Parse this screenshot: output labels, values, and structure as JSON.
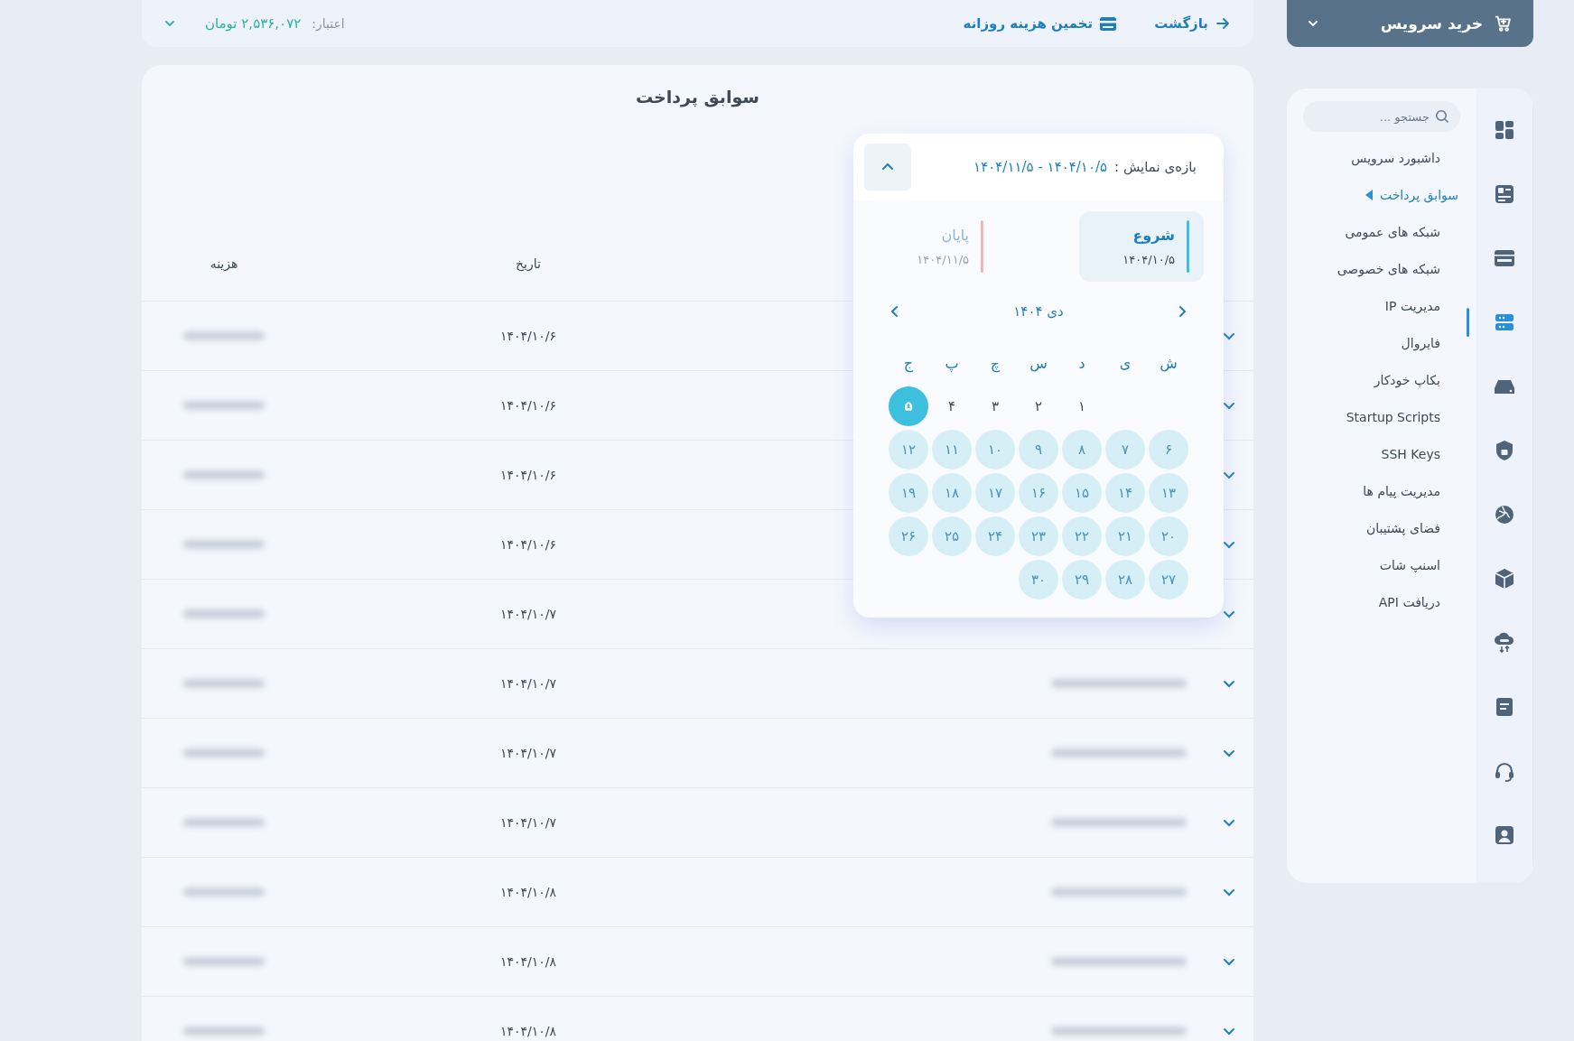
{
  "top_bar": {
    "back": "بازگشت",
    "estimate": "تخمین هزینه روزانه",
    "credit_label": "اعتبار:",
    "credit_value": "۲,۵۳۶,۰۷۲ تومان"
  },
  "buy_button": {
    "label": "خرید سرویس"
  },
  "search": {
    "placeholder": "جستجو ..."
  },
  "menu": [
    {
      "label": "داشبورد سرویس",
      "selected": false
    },
    {
      "label": "سوابق پرداخت",
      "selected": true
    },
    {
      "label": "شبکه های عمومی",
      "selected": false
    },
    {
      "label": "شبکه های خصوصی",
      "selected": false
    },
    {
      "label": "مدیریت IP",
      "selected": false
    },
    {
      "label": "فایروال",
      "selected": false
    },
    {
      "label": "بکاپ خودکار",
      "selected": false
    },
    {
      "label": "Startup Scripts",
      "selected": false
    },
    {
      "label": "SSH Keys",
      "selected": false
    },
    {
      "label": "مدیریت پیام ها",
      "selected": false
    },
    {
      "label": "فضای پشتیبان",
      "selected": false
    },
    {
      "label": "اسنپ شات",
      "selected": false
    },
    {
      "label": "دریافت API",
      "selected": false
    }
  ],
  "rail": [
    {
      "kind": "grid",
      "selected": false
    },
    {
      "kind": "dashboard",
      "selected": false
    },
    {
      "kind": "web",
      "selected": false
    },
    {
      "kind": "server",
      "selected": true
    },
    {
      "kind": "drive",
      "selected": false
    },
    {
      "kind": "shield",
      "selected": false
    },
    {
      "kind": "globe",
      "selected": false
    },
    {
      "kind": "cube",
      "selected": false
    },
    {
      "kind": "cloud",
      "selected": false
    },
    {
      "kind": "document",
      "selected": false
    },
    {
      "kind": "headset",
      "selected": false
    },
    {
      "kind": "user",
      "selected": false
    }
  ],
  "page_title": "سوابق پرداخت",
  "table": {
    "columns": [
      {
        "label": "تاریخ"
      },
      {
        "label": "هزینه"
      }
    ],
    "rows": [
      {
        "date": "۱۴۰۴/۱۰/۶"
      },
      {
        "date": "۱۴۰۴/۱۰/۶"
      },
      {
        "date": "۱۴۰۴/۱۰/۶"
      },
      {
        "date": "۱۴۰۴/۱۰/۶"
      },
      {
        "date": "۱۴۰۴/۱۰/۷"
      },
      {
        "date": "۱۴۰۴/۱۰/۷"
      },
      {
        "date": "۱۴۰۴/۱۰/۷"
      },
      {
        "date": "۱۴۰۴/۱۰/۷"
      },
      {
        "date": "۱۴۰۴/۱۰/۸"
      },
      {
        "date": "۱۴۰۴/۱۰/۸"
      },
      {
        "date": "۱۴۰۴/۱۰/۸"
      }
    ]
  },
  "date_picker": {
    "range_label": "بازه‌ی نمایش :",
    "range_value": "۱۴۰۴/۱۰/۵ - ۱۴۰۴/۱۱/۵",
    "expanded": true,
    "start": {
      "label": "شروع",
      "date": "۱۴۰۴/۱۰/۵",
      "selected": true
    },
    "end": {
      "label": "پایان",
      "date": "۱۴۰۴/۱۱/۵",
      "selected": false
    },
    "month": "دی ۱۴۰۴",
    "weekdays": [
      "ش",
      "ی",
      "د",
      "س",
      "چ",
      "پ",
      "ج"
    ],
    "weeks": [
      [
        {
          "kind": "blank"
        },
        {
          "kind": "blank"
        },
        {
          "kind": "day",
          "label": "۱",
          "selected": false,
          "in_range": false
        },
        {
          "kind": "day",
          "label": "۲",
          "selected": false,
          "in_range": false
        },
        {
          "kind": "day",
          "label": "۳",
          "selected": false,
          "in_range": false
        },
        {
          "kind": "day",
          "label": "۴",
          "selected": false,
          "in_range": false
        },
        {
          "kind": "day",
          "label": "۵",
          "selected": true,
          "in_range": false
        }
      ],
      [
        {
          "kind": "day",
          "label": "۶",
          "selected": false,
          "in_range": true
        },
        {
          "kind": "day",
          "label": "۷",
          "selected": false,
          "in_range": true
        },
        {
          "kind": "day",
          "label": "۸",
          "selected": false,
          "in_range": true
        },
        {
          "kind": "day",
          "label": "۹",
          "selected": false,
          "in_range": true
        },
        {
          "kind": "day",
          "label": "۱۰",
          "selected": false,
          "in_range": true
        },
        {
          "kind": "day",
          "label": "۱۱",
          "selected": false,
          "in_range": true
        },
        {
          "kind": "day",
          "label": "۱۲",
          "selected": false,
          "in_range": true
        }
      ],
      [
        {
          "kind": "day",
          "label": "۱۳",
          "selected": false,
          "in_range": true
        },
        {
          "kind": "day",
          "label": "۱۴",
          "selected": false,
          "in_range": true
        },
        {
          "kind": "day",
          "label": "۱۵",
          "selected": false,
          "in_range": true
        },
        {
          "kind": "day",
          "label": "۱۶",
          "selected": false,
          "in_range": true
        },
        {
          "kind": "day",
          "label": "۱۷",
          "selected": false,
          "in_range": true
        },
        {
          "kind": "day",
          "label": "۱۸",
          "selected": false,
          "in_range": true
        },
        {
          "kind": "day",
          "label": "۱۹",
          "selected": false,
          "in_range": true
        }
      ],
      [
        {
          "kind": "day",
          "label": "۲۰",
          "selected": false,
          "in_range": true
        },
        {
          "kind": "day",
          "label": "۲۱",
          "selected": false,
          "in_range": true
        },
        {
          "kind": "day",
          "label": "۲۲",
          "selected": false,
          "in_range": true
        },
        {
          "kind": "day",
          "label": "۲۳",
          "selected": false,
          "in_range": true
        },
        {
          "kind": "day",
          "label": "۲۴",
          "selected": false,
          "in_range": true
        },
        {
          "kind": "day",
          "label": "۲۵",
          "selected": false,
          "in_range": true
        },
        {
          "kind": "day",
          "label": "۲۶",
          "selected": false,
          "in_range": true
        }
      ],
      [
        {
          "kind": "day",
          "label": "۲۷",
          "selected": false,
          "in_range": true
        },
        {
          "kind": "day",
          "label": "۲۸",
          "selected": false,
          "in_range": true
        },
        {
          "kind": "day",
          "label": "۲۹",
          "selected": false,
          "in_range": true
        },
        {
          "kind": "day",
          "label": "۳۰",
          "selected": false,
          "in_range": true
        }
      ]
    ]
  }
}
